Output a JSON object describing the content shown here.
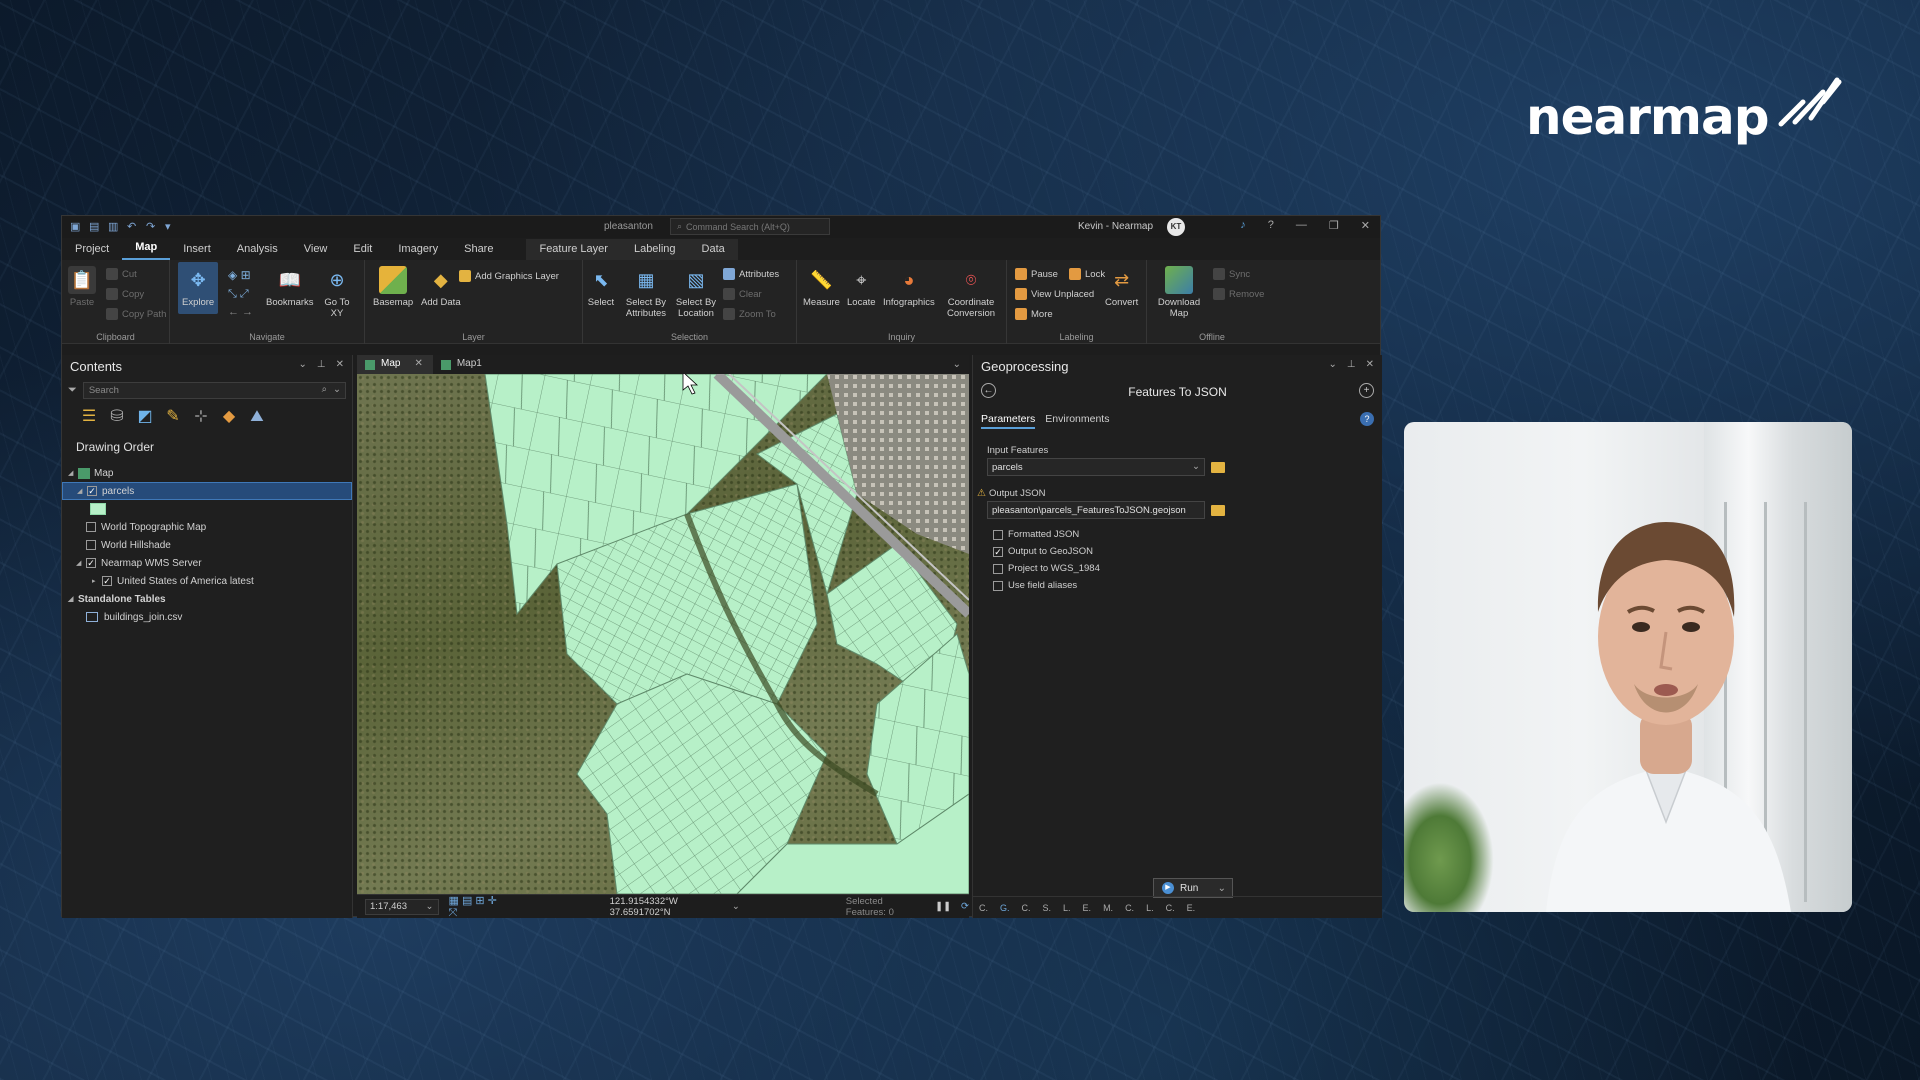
{
  "brand": {
    "name": "nearmap"
  },
  "app": {
    "project_name": "pleasanton",
    "command_search_placeholder": "Command Search (Alt+Q)",
    "user_name": "Kevin - Nearmap",
    "user_initials": "KT",
    "ribbon_tabs": [
      "Project",
      "Map",
      "Insert",
      "Analysis",
      "View",
      "Edit",
      "Imagery",
      "Share"
    ],
    "context_tabs": [
      "Feature Layer",
      "Labeling",
      "Data"
    ],
    "ribbon": {
      "clipboard": {
        "label": "Clipboard",
        "paste": "Paste",
        "cut": "Cut",
        "copy": "Copy",
        "copy_path": "Copy Path"
      },
      "navigate": {
        "label": "Navigate",
        "explore": "Explore",
        "bookmarks": "Bookmarks",
        "go_to_xy": "Go To XY"
      },
      "layer": {
        "label": "Layer",
        "basemap": "Basemap",
        "add_data": "Add Data",
        "add_graphics_layer": "Add Graphics Layer"
      },
      "selection": {
        "label": "Selection",
        "select": "Select",
        "select_by_attributes": "Select By Attributes",
        "select_by_location": "Select By Location",
        "attributes": "Attributes",
        "clear": "Clear",
        "zoom_to": "Zoom To"
      },
      "inquiry": {
        "label": "Inquiry",
        "measure": "Measure",
        "locate": "Locate",
        "infographics": "Infographics",
        "coordinate_conversion": "Coordinate Conversion"
      },
      "labeling": {
        "label": "Labeling",
        "pause": "Pause",
        "lock": "Lock",
        "view_unplaced": "View Unplaced",
        "more": "More",
        "convert": "Convert"
      },
      "offline": {
        "label": "Offline",
        "download_map": "Download Map",
        "sync": "Sync",
        "remove": "Remove"
      }
    },
    "contents": {
      "title": "Contents",
      "search_placeholder": "Search",
      "drawing_order": "Drawing Order",
      "tree": [
        {
          "label": "Map",
          "level": 0
        },
        {
          "label": "parcels",
          "level": 1,
          "checked": true,
          "selected": true
        },
        {
          "label": "World Topographic Map",
          "level": 1,
          "checked": false
        },
        {
          "label": "World Hillshade",
          "level": 1,
          "checked": false
        },
        {
          "label": "Nearmap WMS Server",
          "level": 1,
          "checked": true
        },
        {
          "label": "United States of America latest",
          "level": 2,
          "checked": true
        },
        {
          "label": "Standalone Tables",
          "level": 0
        },
        {
          "label": "buildings_join.csv",
          "level": 1
        }
      ]
    },
    "map_tabs": [
      "Map",
      "Map1"
    ],
    "status": {
      "scale": "1:17,463",
      "coords": "121.9154332°W 37.6591702°N",
      "selected_features": "Selected Features: 0"
    },
    "geoprocessing": {
      "title": "Geoprocessing",
      "tool": "Features To JSON",
      "tabs": [
        "Parameters",
        "Environments"
      ],
      "input_label": "Input Features",
      "input_value": "parcels",
      "output_label": "Output JSON",
      "output_value": "pleasanton\\parcels_FeaturesToJSON.geojson",
      "options": [
        {
          "label": "Formatted JSON",
          "checked": false
        },
        {
          "label": "Output to GeoJSON",
          "checked": true
        },
        {
          "label": "Project to WGS_1984",
          "checked": false
        },
        {
          "label": "Use field aliases",
          "checked": false
        }
      ],
      "run_label": "Run",
      "bottom_tabs": [
        "C.",
        "G.",
        "C.",
        "S.",
        "L.",
        "E.",
        "M.",
        "C.",
        "L.",
        "C.",
        "E."
      ]
    }
  },
  "colors": {
    "parcel_fill": "#b7f0c8",
    "accent": "#5a9fd8",
    "app_bg": "#1d1d1d"
  }
}
